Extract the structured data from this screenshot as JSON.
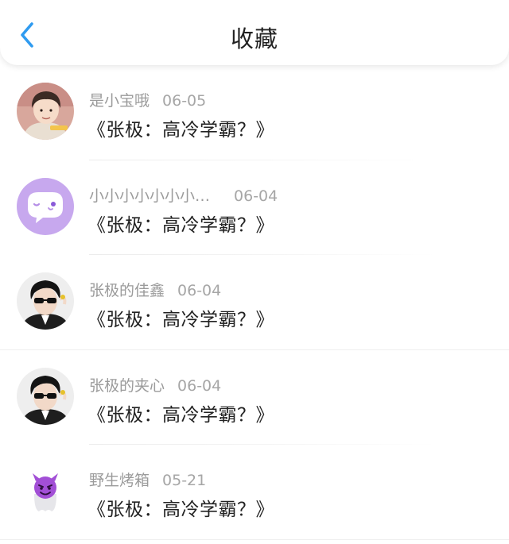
{
  "header": {
    "title": "收藏"
  },
  "colors": {
    "accent": "#2f9bf0",
    "text_primary": "#222222",
    "text_secondary": "#9b9b9b",
    "chat_avatar_bg": "#c7a8ee"
  },
  "favorites": [
    {
      "username": "是小宝哦",
      "date": "06-05",
      "title": "《张极：高冷学霸？》",
      "avatar_icon": "child-avatar"
    },
    {
      "username": "小小小小小小小…",
      "date": "06-04",
      "title": "《张极：高冷学霸？》",
      "avatar_icon": "chat-bubble-avatar"
    },
    {
      "username": "张极的佳鑫",
      "date": "06-04",
      "title": "《张极：高冷学霸？》",
      "avatar_icon": "sunglasses-avatar"
    },
    {
      "username": "张极的夹心",
      "date": "06-04",
      "title": "《张极：高冷学霸？》",
      "avatar_icon": "sunglasses-avatar"
    },
    {
      "username": "野生烤箱",
      "date": "05-21",
      "title": "《张极：高冷学霸？》",
      "avatar_icon": "devil-ghost-avatar"
    }
  ]
}
